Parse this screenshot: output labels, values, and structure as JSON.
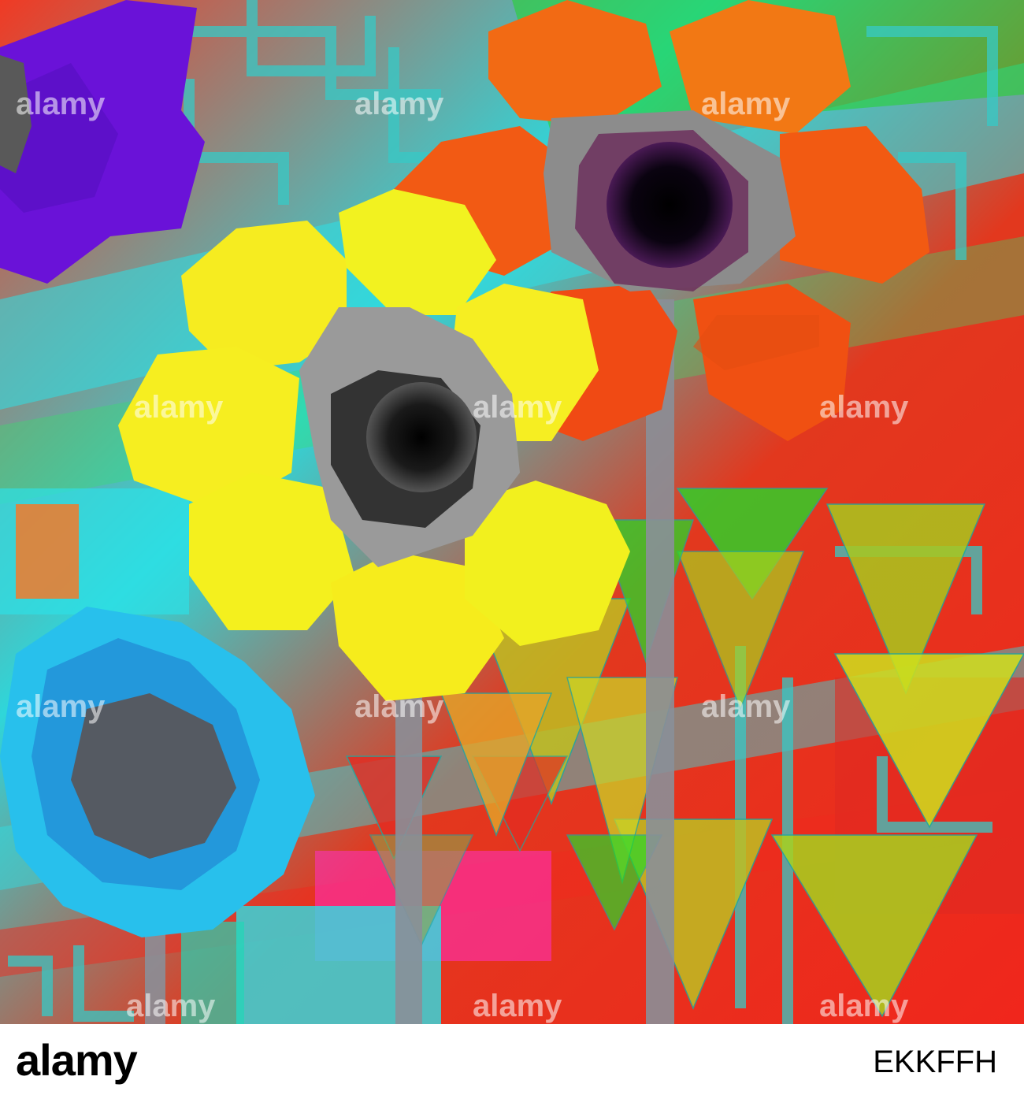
{
  "image": {
    "subject": "abstract flowers",
    "flowers": [
      "purple",
      "yellow",
      "orange",
      "blue"
    ],
    "palette": {
      "background_red": "#f02a1e",
      "background_cyan": "#2de0e6",
      "background_green": "#22d626",
      "purple_flower": "#6a12d8",
      "yellow_flower": "#f6f21a",
      "orange_flower": "#f25812",
      "blue_flower": "#24b6ea",
      "flower_center": "#050505",
      "stem": "#8a8f98"
    }
  },
  "watermark": {
    "text": "alamy"
  },
  "footer": {
    "logo": "alamy",
    "image_id": "EKKFFH"
  }
}
